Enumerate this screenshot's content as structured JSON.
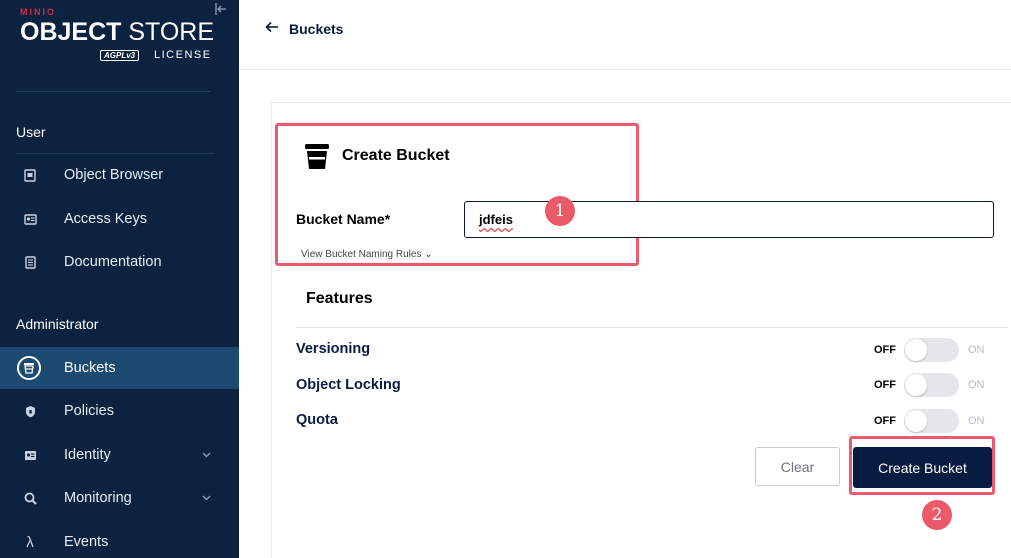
{
  "sidebar": {
    "brand": {
      "minio": "MINIO",
      "title_bold": "OBJECT",
      "title_light": " STORE",
      "agpl": "AGPLv3",
      "license": "LICENSE"
    },
    "sections": [
      {
        "label": "User"
      },
      {
        "label": "Administrator"
      }
    ],
    "items": [
      {
        "label": "Object Browser",
        "icon": "object-browser-icon"
      },
      {
        "label": "Access Keys",
        "icon": "access-keys-icon"
      },
      {
        "label": "Documentation",
        "icon": "documentation-icon"
      },
      {
        "label": "Buckets",
        "icon": "buckets-icon",
        "active": true
      },
      {
        "label": "Policies",
        "icon": "policies-icon"
      },
      {
        "label": "Identity",
        "icon": "identity-icon",
        "expandable": true
      },
      {
        "label": "Monitoring",
        "icon": "monitoring-icon",
        "expandable": true
      },
      {
        "label": "Events",
        "icon": "lambda-icon",
        "glyph": "λ"
      }
    ]
  },
  "topbar": {
    "back_label": "Buckets"
  },
  "form": {
    "title": "Create Bucket",
    "bucket_name_label": "Bucket Name*",
    "bucket_name_value": "jdfeis",
    "naming_rules_link": "View Bucket Naming Rules ⌄",
    "features_title": "Features",
    "features": [
      {
        "label": "Versioning",
        "off": "OFF",
        "on": "ON",
        "enabled": false
      },
      {
        "label": "Object Locking",
        "off": "OFF",
        "on": "ON",
        "enabled": false
      },
      {
        "label": "Quota",
        "off": "OFF",
        "on": "ON",
        "enabled": false
      }
    ],
    "clear_label": "Clear",
    "create_label": "Create Bucket"
  },
  "annotations": {
    "badge1": "1",
    "badge2": "2",
    "color": "#ec5a6d"
  },
  "colors": {
    "sidebar_bg": "#0c2340",
    "active_item": "#1c4a70",
    "primary": "#081c42",
    "brand_red": "#c72c48"
  }
}
